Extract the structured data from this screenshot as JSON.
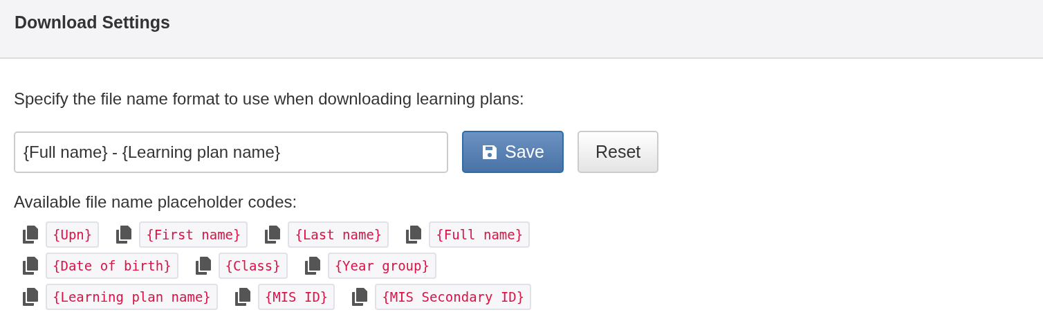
{
  "panel": {
    "title": "Download Settings"
  },
  "instruction": "Specify the file name format to use when downloading learning plans:",
  "format_field": {
    "value": "{Full name} - {Learning plan name}"
  },
  "buttons": [
    {
      "label": "Save",
      "kind": "primary"
    },
    {
      "label": "Reset",
      "kind": "default"
    }
  ],
  "codes_label": "Available file name placeholder codes:",
  "code_rows": [
    [
      "{Upn}",
      "{First name}",
      "{Last name}",
      "{Full name}"
    ],
    [
      "{Date of birth}",
      "{Class}",
      "{Year group}"
    ],
    [
      "{Learning plan name}",
      "{MIS ID}",
      "{MIS Secondary ID}"
    ]
  ]
}
